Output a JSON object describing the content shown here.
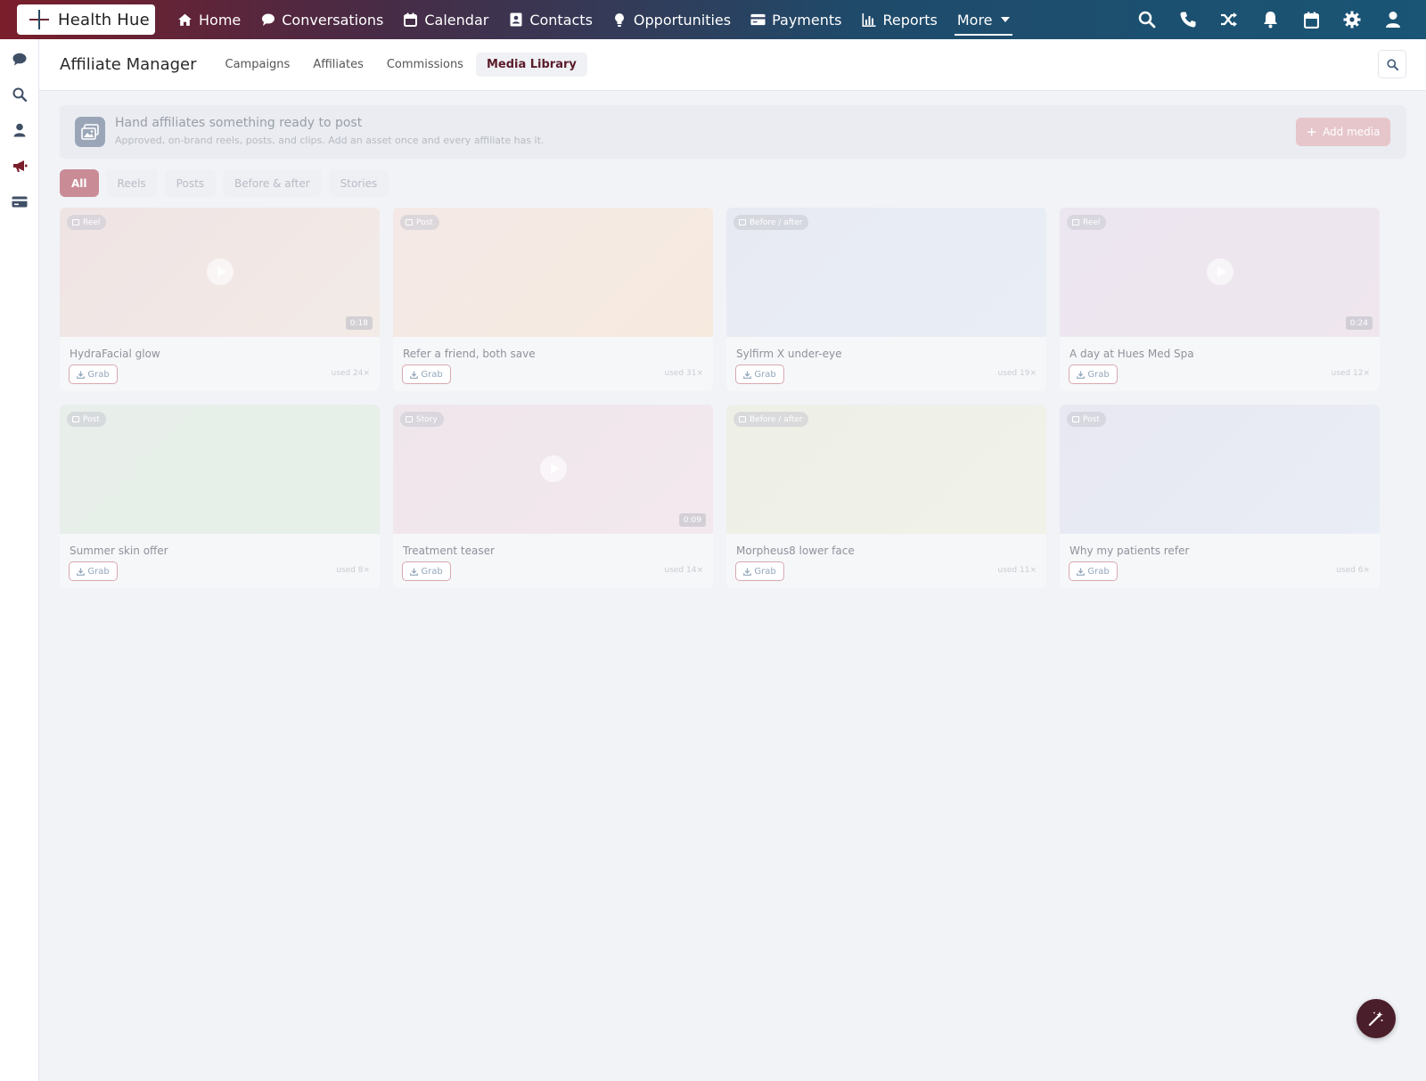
{
  "app": {
    "brand": "Health Hue"
  },
  "nav": {
    "items": [
      {
        "label": "Home",
        "icon": "home-icon"
      },
      {
        "label": "Conversations",
        "icon": "chat-icon"
      },
      {
        "label": "Calendar",
        "icon": "calendar-icon"
      },
      {
        "label": "Contacts",
        "icon": "contact-card-icon"
      },
      {
        "label": "Opportunities",
        "icon": "lightbulb-icon"
      },
      {
        "label": "Payments",
        "icon": "credit-card-icon"
      },
      {
        "label": "Reports",
        "icon": "bar-chart-icon"
      },
      {
        "label": "More",
        "icon": "chevron-down-icon"
      }
    ],
    "tools": [
      "search-icon",
      "phone-icon",
      "shuffle-icon",
      "bell-icon",
      "calendar-icon",
      "gear-icon",
      "user-icon"
    ]
  },
  "rail": {
    "icons": [
      "chat-icon",
      "search-icon",
      "user-icon",
      "megaphone-icon",
      "card-icon"
    ]
  },
  "subheader": {
    "title": "Affiliate Manager",
    "tabs": [
      {
        "label": "Campaigns"
      },
      {
        "label": "Affiliates"
      },
      {
        "label": "Commissions"
      },
      {
        "label": "Media Library",
        "active": true
      }
    ]
  },
  "banner": {
    "title": "Hand affiliates something ready to post",
    "subtitle": "Approved, on-brand reels, posts, and clips. Add an asset once and every affiliate has it.",
    "add_label": "Add media"
  },
  "filters": [
    "All",
    "Reels",
    "Posts",
    "Before & after",
    "Stories"
  ],
  "media": [
    {
      "type": "Reel",
      "title": "HydraFacial glow",
      "duration": "0:18",
      "used": "used 24×",
      "grab": "Grab",
      "video": true,
      "tint": [
        "#efe4e4",
        "#f3ebe6"
      ]
    },
    {
      "type": "Post",
      "title": "Refer a friend, both save",
      "duration": "",
      "used": "used 31×",
      "grab": "Grab",
      "video": false,
      "tint": [
        "#f4e9e6",
        "#f6eadf"
      ]
    },
    {
      "type": "Before / after",
      "title": "Sylfirm X under-eye",
      "duration": "",
      "used": "used 19×",
      "grab": "Grab",
      "video": false,
      "tint": [
        "#e7eaf2",
        "#e9eef6"
      ]
    },
    {
      "type": "Reel",
      "title": "A day at Hues Med Spa",
      "duration": "0:24",
      "used": "used 12×",
      "grab": "Grab",
      "video": true,
      "tint": [
        "#ece6f0",
        "#efe6ee"
      ]
    },
    {
      "type": "Post",
      "title": "Summer skin offer",
      "duration": "",
      "used": "used 8×",
      "grab": "Grab",
      "video": false,
      "tint": [
        "#e8efea",
        "#e6efe8"
      ]
    },
    {
      "type": "Story",
      "title": "Treatment teaser",
      "duration": "0:09",
      "used": "used 14×",
      "grab": "Grab",
      "video": true,
      "tint": [
        "#efe6ec",
        "#f2e8ee"
      ]
    },
    {
      "type": "Before / after",
      "title": "Morpheus8 lower face",
      "duration": "",
      "used": "used 11×",
      "grab": "Grab",
      "video": false,
      "tint": [
        "#eef0e7",
        "#f0f1e8"
      ]
    },
    {
      "type": "Post",
      "title": "Why my patients refer",
      "duration": "",
      "used": "used 6×",
      "grab": "Grab",
      "video": false,
      "tint": [
        "#e8e8f2",
        "#e9edf5"
      ]
    }
  ],
  "colors": {
    "accent": "#c98c97",
    "brand_dark": "#4a1e2a",
    "nav_start": "#7a1e2b",
    "nav_end": "#1a5575"
  }
}
